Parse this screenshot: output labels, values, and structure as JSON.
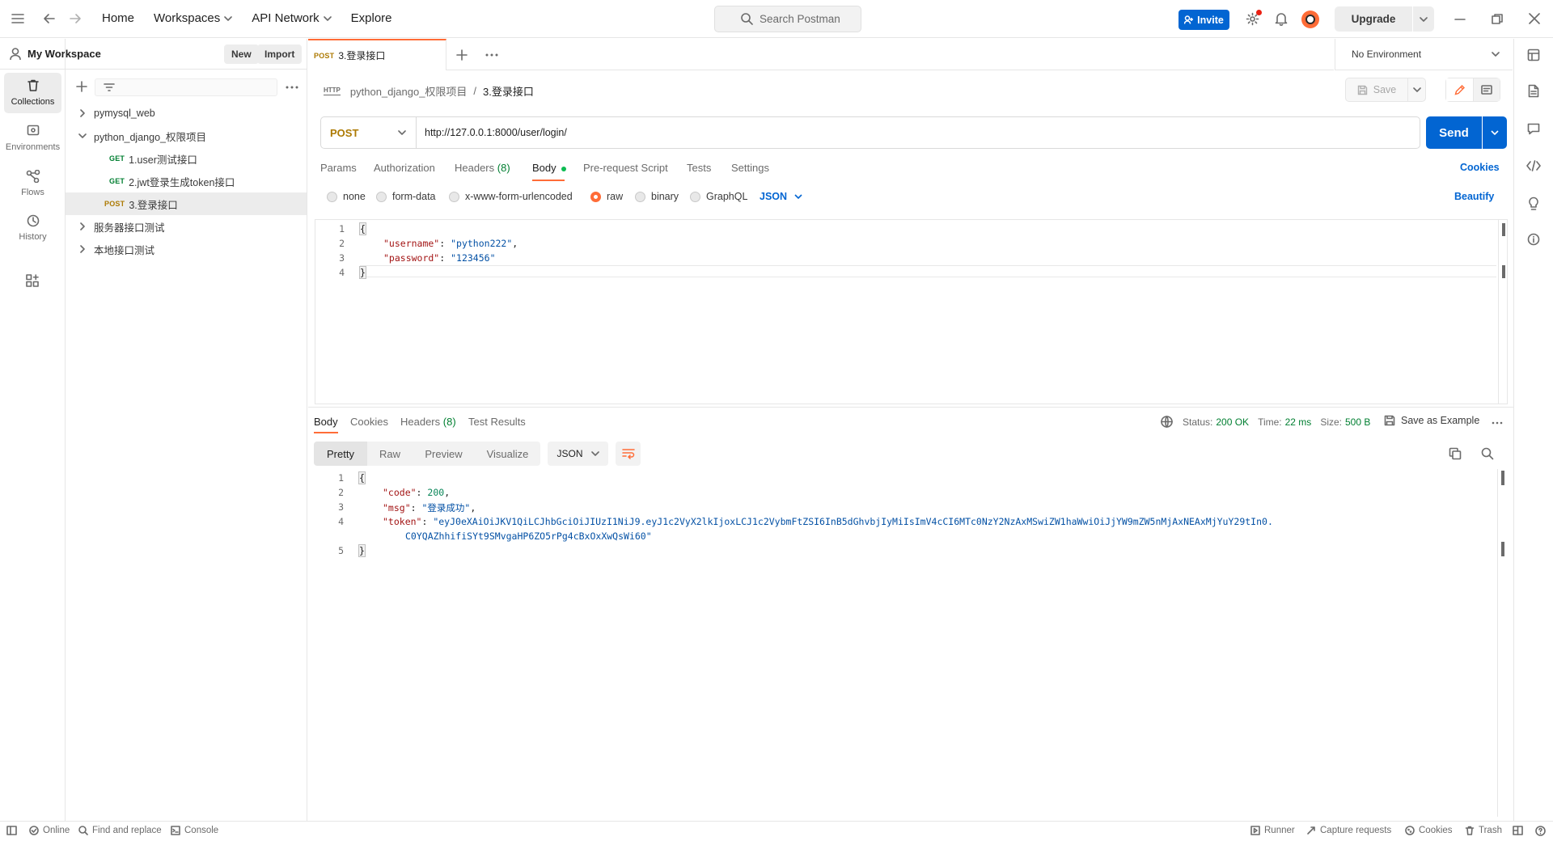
{
  "topbar": {
    "nav": [
      "Home",
      "Workspaces",
      "API Network",
      "Explore"
    ],
    "search_placeholder": "Search Postman",
    "invite": "Invite",
    "upgrade": "Upgrade"
  },
  "workspace": {
    "name": "My Workspace",
    "new_label": "New",
    "import_label": "Import"
  },
  "rail": [
    "Collections",
    "Environments",
    "Flows",
    "History"
  ],
  "tree": [
    {
      "label": "pymysql_web",
      "type": "folder",
      "expanded": false
    },
    {
      "label": "python_django_权限项目",
      "type": "folder",
      "expanded": true
    },
    {
      "label": "1.user测试接口",
      "type": "request",
      "method": "GET"
    },
    {
      "label": "2.jwt登录生成token接口",
      "type": "request",
      "method": "GET"
    },
    {
      "label": "3.登录接口",
      "type": "request",
      "method": "POST",
      "active": true
    },
    {
      "label": "服务器接口测试",
      "type": "folder",
      "expanded": false
    },
    {
      "label": "本地接口测试",
      "type": "folder",
      "expanded": false
    }
  ],
  "tab": {
    "method": "POST",
    "title": "3.登录接口"
  },
  "environment": "No Environment",
  "breadcrumb": {
    "parent": "python_django_权限项目",
    "sep": "/",
    "current": "3.登录接口",
    "badge": "HTTP"
  },
  "save_label": "Save",
  "request": {
    "method": "POST",
    "url": "http://127.0.0.1:8000/user/login/",
    "send": "Send",
    "tabs": {
      "params": "Params",
      "auth": "Authorization",
      "headers": "Headers",
      "headers_count": "(8)",
      "body": "Body",
      "prerequest": "Pre-request Script",
      "tests": "Tests",
      "settings": "Settings"
    },
    "cookies": "Cookies",
    "beautify": "Beautify",
    "body_types": [
      "none",
      "form-data",
      "x-www-form-urlencoded",
      "raw",
      "binary",
      "GraphQL"
    ],
    "selected_body_type": "raw",
    "format": "JSON",
    "body_lines": {
      "l1": "{",
      "l2_key": "\"username\"",
      "l2_val": "\"python222\"",
      "l3_key": "\"password\"",
      "l3_val": "\"123456\"",
      "l4": "}"
    }
  },
  "response": {
    "tabs": {
      "body": "Body",
      "cookies": "Cookies",
      "headers": "Headers",
      "headers_count": "(8)",
      "tests": "Test Results"
    },
    "status_label": "Status:",
    "status": "200 OK",
    "time_label": "Time:",
    "time": "22 ms",
    "size_label": "Size:",
    "size": "500 B",
    "save_example": "Save as Example",
    "views": [
      "Pretty",
      "Raw",
      "Preview",
      "Visualize"
    ],
    "format": "JSON",
    "lines": {
      "l1": "{",
      "code_key": "\"code\"",
      "code_val": "200",
      "msg_key": "\"msg\"",
      "msg_val": "\"登录成功\"",
      "token_key": "\"token\"",
      "token_val_1": "\"eyJ0eXAiOiJKV1QiLCJhbGciOiJIUzI1NiJ9.eyJ1c2VyX2lkIjoxLCJ1c2VybmFtZSI6InB5dGhvbjIyMiIsImV4cCI6MTc0NzY2NzAxMSwiZW1haWwiOiJjYW9mZW5nMjAxNEAxMjYuY29tIn0.",
      "token_val_2": "C0YQAZhhifiSYt9SMvgaHP6ZO5rPg4cBxOxXwQsWi60\"",
      "l5": "}"
    }
  },
  "statusbar": {
    "online": "Online",
    "find": "Find and replace",
    "console": "Console",
    "runner": "Runner",
    "capture": "Capture requests",
    "cookies": "Cookies",
    "trash": "Trash"
  },
  "colors": {
    "accent": "#ff6c37",
    "primary": "#0265d2",
    "get": "#007f31",
    "post": "#ad7a03"
  }
}
